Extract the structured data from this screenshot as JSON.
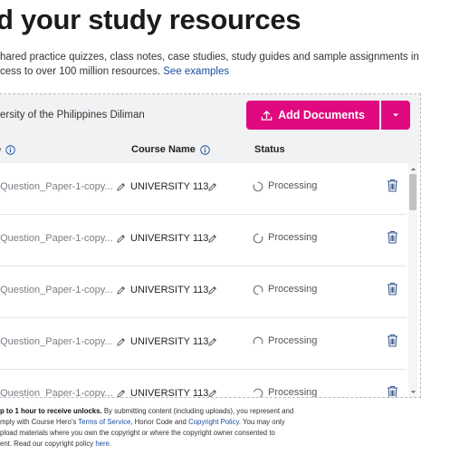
{
  "header": {
    "title": "d your study resources",
    "subtitle_line1": "hared practice quizzes, class notes, case studies, study guides and sample assignments in",
    "subtitle_line2_prefix": "cess to over 100 million resources. ",
    "see_examples": "See examples"
  },
  "panel": {
    "school_name": "ersity of the Philippines Diliman",
    "add_button_label": "Add Documents",
    "columns": {
      "title": "le",
      "course": "Course Name",
      "status": "Status"
    },
    "rows": [
      {
        "title": "_Question_Paper-1-copy...",
        "course": "UNIVERSITY 113",
        "status": "Processing"
      },
      {
        "title": "_Question_Paper-1-copy...",
        "course": "UNIVERSITY 113",
        "status": "Processing"
      },
      {
        "title": "_Question_Paper-1-copy...",
        "course": "UNIVERSITY 113",
        "status": "Processing"
      },
      {
        "title": "_Question_Paper-1-copy...",
        "course": "UNIVERSITY 113",
        "status": "Processing"
      },
      {
        "title": "_Question_Paper-1-copy...",
        "course": "UNIVERSITY 113",
        "status": "Processing"
      }
    ]
  },
  "disclaimer": {
    "bold": "p to 1 hour to receive unlocks.",
    "line1_rest": " By submitting content (including uploads), you represent and",
    "line2_prefix": "mply with Course Hero's ",
    "tos": "Terms of Service",
    "line2_mid": ", Honor Code and ",
    "copyright_policy": "Copyright Policy",
    "line2_suffix": ". You may only",
    "line3": "pload materials where you own the copyright or where the copyright owner consented to",
    "line4_prefix": "ent. Read our copyright policy ",
    "here": "here",
    "line4_suffix": "."
  },
  "colors": {
    "accent": "#e0097f",
    "link": "#1a4fa3"
  },
  "icons": {
    "upload": "upload-icon",
    "dropdown": "chevron-down-icon",
    "info": "info-icon",
    "edit": "pencil-icon",
    "processing": "spinner-icon",
    "delete": "trash-icon"
  }
}
